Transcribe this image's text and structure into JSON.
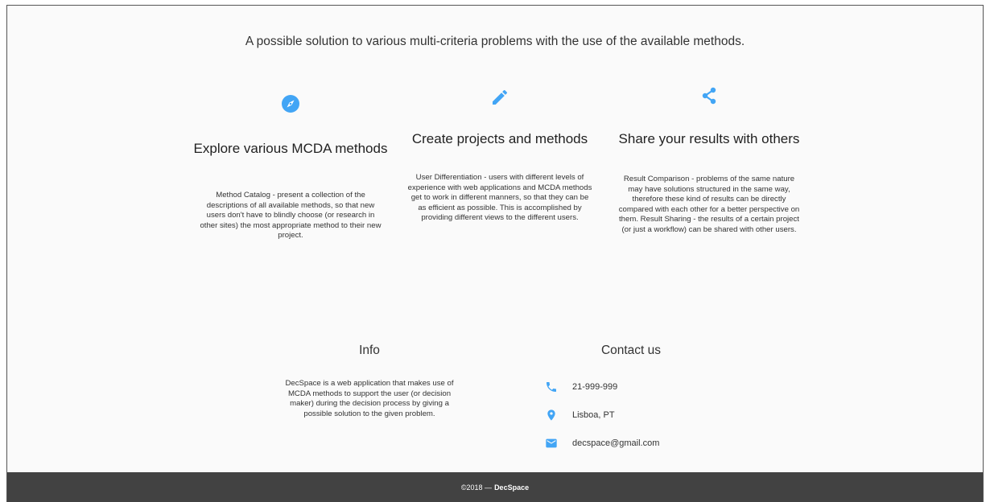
{
  "tagline": "A possible solution to various multi-criteria problems with the use of the available methods.",
  "colors": {
    "accent": "#42a5f5",
    "footer_bg": "#424242"
  },
  "features": [
    {
      "icon": "compass-icon",
      "title": "Explore various MCDA methods",
      "text": "Method Catalog - present a collection of the descriptions of all available methods, so that new users don't have to blindly choose (or research in other sites) the most appropriate method to their new project."
    },
    {
      "icon": "pencil-icon",
      "title": "Create projects and methods",
      "text": "User Differentiation - users with different levels of experience with web applications and MCDA methods get to work in different manners, so that they can be as efficient as possible. This is accomplished by providing different views to the different users."
    },
    {
      "icon": "share-icon",
      "title": "Share your results with others",
      "text": "Result Comparison - problems of the same nature may have solutions structured in the same way, therefore these kind of results can be directly compared with each other for a better perspective on them. Result Sharing - the results of a certain project (or just a workflow) can be shared with other users."
    }
  ],
  "info": {
    "title": "Info",
    "text": "DecSpace is a web application that makes use of MCDA methods to support the user (or decision maker) during the decision process by giving a possible solution to the given problem."
  },
  "contact": {
    "title": "Contact us",
    "items": [
      {
        "icon": "phone-icon",
        "text": "21-999-999"
      },
      {
        "icon": "location-pin-icon",
        "text": "Lisboa, PT"
      },
      {
        "icon": "mail-icon",
        "text": "decspace@gmail.com"
      }
    ]
  },
  "footer": {
    "copyright": "©2018 —",
    "brand": "DecSpace"
  }
}
